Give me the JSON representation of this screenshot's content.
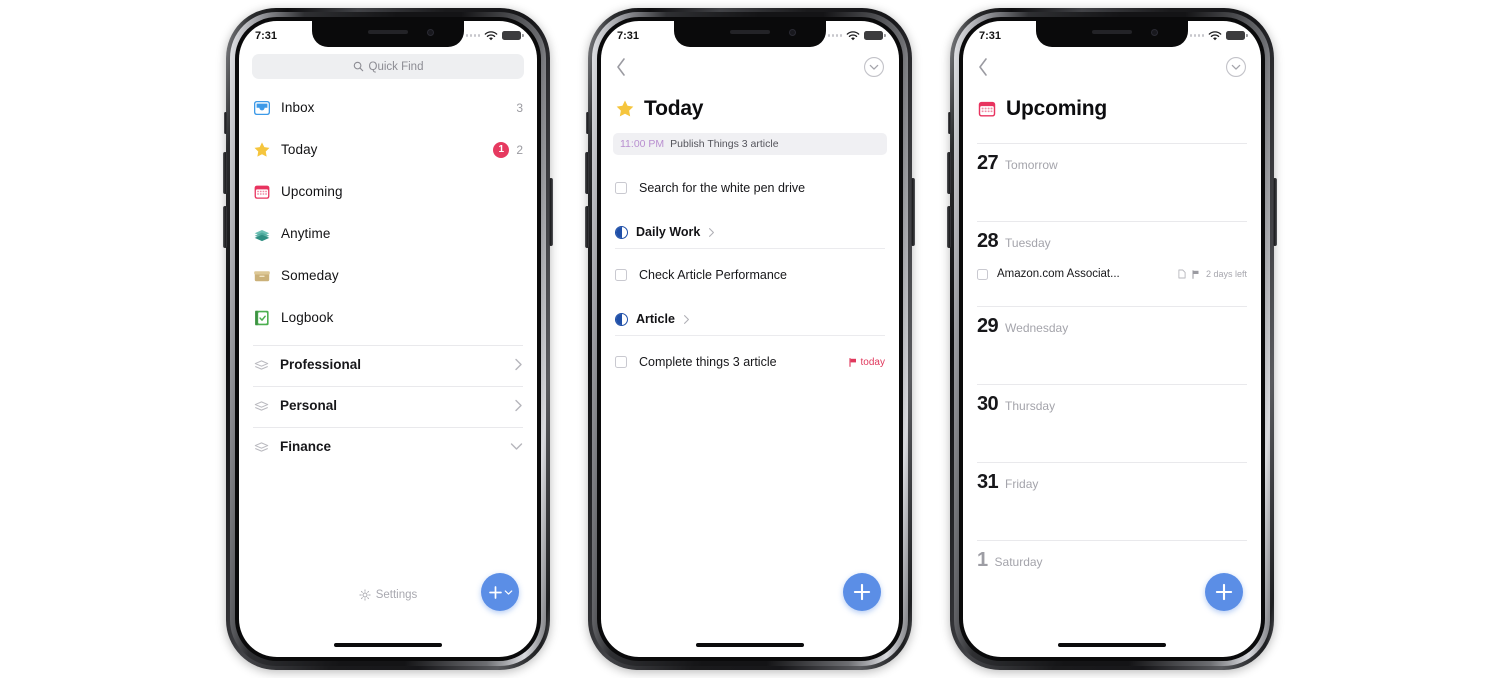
{
  "colors": {
    "accent_blue": "#5b8ee6",
    "badge_red": "#e63a60",
    "today_yellow": "#f5c53d",
    "upcoming_red": "#e8335f",
    "anytime_teal": "#3b9e8f",
    "someday_tan": "#cbb179",
    "logbook_green": "#4caf50",
    "inbox_blue": "#3d9ae8",
    "project_blue": "#1f4fa8",
    "event_purple": "#b98fd0"
  },
  "phones": [
    {
      "id": "phone-sidebar",
      "status": {
        "time": "7:31",
        "wifi_icon": "wifi-icon",
        "battery_icon": "battery-icon",
        "signal_icon": "signal-dots-icon"
      },
      "search": {
        "placeholder": "Quick Find",
        "icon": "search-icon"
      },
      "lists": [
        {
          "label": "Inbox",
          "icon": "inbox-icon",
          "count": "3",
          "badge": ""
        },
        {
          "label": "Today",
          "icon": "star-icon",
          "count": "2",
          "badge": "1"
        },
        {
          "label": "Upcoming",
          "icon": "calendar-icon",
          "count": "",
          "badge": ""
        },
        {
          "label": "Anytime",
          "icon": "layers-icon",
          "count": "",
          "badge": ""
        },
        {
          "label": "Someday",
          "icon": "box-icon",
          "count": "",
          "badge": ""
        },
        {
          "label": "Logbook",
          "icon": "logbook-icon",
          "count": "",
          "badge": ""
        }
      ],
      "areas": [
        {
          "label": "Professional",
          "icon": "area-icon",
          "chevron": "chevron-right-icon"
        },
        {
          "label": "Personal",
          "icon": "area-icon",
          "chevron": "chevron-right-icon"
        },
        {
          "label": "Finance",
          "icon": "area-icon",
          "chevron": "chevron-down-icon"
        }
      ],
      "settings": {
        "label": "Settings",
        "icon": "gear-icon"
      },
      "fab": {
        "icon": "plus-icon",
        "secondary_icon": "chevron-down-icon"
      }
    },
    {
      "id": "phone-today",
      "status": {
        "time": "7:31"
      },
      "nav": {
        "back_icon": "chevron-left-icon",
        "collapse_icon": "collapse-circle-icon"
      },
      "title": {
        "text": "Today",
        "icon": "star-icon"
      },
      "event": {
        "time": "11:00 PM",
        "name": "Publish Things 3 article"
      },
      "loose_tasks": [
        {
          "name": "Search for the white pen drive",
          "checkbox": "checkbox-icon"
        }
      ],
      "projects": [
        {
          "name": "Daily Work",
          "icon": "project-progress-icon",
          "chevron": "chevron-right-icon",
          "tasks": [
            {
              "name": "Check Article Performance",
              "checkbox": "checkbox-icon",
              "tag": "",
              "tag_icon": ""
            }
          ]
        },
        {
          "name": "Article",
          "icon": "project-progress-icon",
          "chevron": "chevron-right-icon",
          "tasks": [
            {
              "name": "Complete things 3 article",
              "checkbox": "checkbox-icon",
              "tag": "today",
              "tag_icon": "flag-icon"
            }
          ]
        }
      ],
      "fab": {
        "icon": "plus-icon"
      }
    },
    {
      "id": "phone-upcoming",
      "status": {
        "time": "7:31"
      },
      "nav": {
        "back_icon": "chevron-left-icon",
        "collapse_icon": "collapse-circle-icon"
      },
      "title": {
        "text": "Upcoming",
        "icon": "calendar-icon"
      },
      "days": [
        {
          "num": "27",
          "name": "Tomorrow",
          "dim": false,
          "tasks": []
        },
        {
          "num": "28",
          "name": "Tuesday",
          "dim": false,
          "tasks": [
            {
              "name": "Amazon.com Associat...",
              "checkbox": "checkbox-icon",
              "note_icon": "note-icon",
              "flag_icon": "flag-icon",
              "meta": "2 days left"
            }
          ]
        },
        {
          "num": "29",
          "name": "Wednesday",
          "dim": false,
          "tasks": []
        },
        {
          "num": "30",
          "name": "Thursday",
          "dim": false,
          "tasks": []
        },
        {
          "num": "31",
          "name": "Friday",
          "dim": false,
          "tasks": []
        },
        {
          "num": "1",
          "name": "Saturday",
          "dim": true,
          "tasks": []
        }
      ],
      "fab": {
        "icon": "plus-icon"
      }
    }
  ]
}
